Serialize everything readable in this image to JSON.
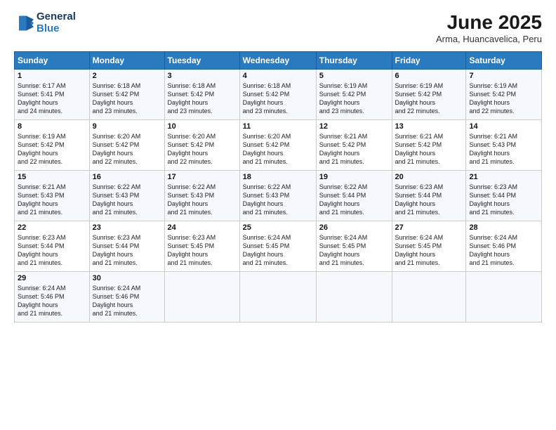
{
  "logo": {
    "general": "General",
    "blue": "Blue"
  },
  "header": {
    "month": "June 2025",
    "location": "Arma, Huancavelica, Peru"
  },
  "weekdays": [
    "Sunday",
    "Monday",
    "Tuesday",
    "Wednesday",
    "Thursday",
    "Friday",
    "Saturday"
  ],
  "weeks": [
    [
      {
        "day": "1",
        "sunrise": "6:17 AM",
        "sunset": "5:41 PM",
        "daylight": "11 hours and 24 minutes."
      },
      {
        "day": "2",
        "sunrise": "6:18 AM",
        "sunset": "5:42 PM",
        "daylight": "11 hours and 23 minutes."
      },
      {
        "day": "3",
        "sunrise": "6:18 AM",
        "sunset": "5:42 PM",
        "daylight": "11 hours and 23 minutes."
      },
      {
        "day": "4",
        "sunrise": "6:18 AM",
        "sunset": "5:42 PM",
        "daylight": "11 hours and 23 minutes."
      },
      {
        "day": "5",
        "sunrise": "6:19 AM",
        "sunset": "5:42 PM",
        "daylight": "11 hours and 23 minutes."
      },
      {
        "day": "6",
        "sunrise": "6:19 AM",
        "sunset": "5:42 PM",
        "daylight": "11 hours and 22 minutes."
      },
      {
        "day": "7",
        "sunrise": "6:19 AM",
        "sunset": "5:42 PM",
        "daylight": "11 hours and 22 minutes."
      }
    ],
    [
      {
        "day": "8",
        "sunrise": "6:19 AM",
        "sunset": "5:42 PM",
        "daylight": "11 hours and 22 minutes."
      },
      {
        "day": "9",
        "sunrise": "6:20 AM",
        "sunset": "5:42 PM",
        "daylight": "11 hours and 22 minutes."
      },
      {
        "day": "10",
        "sunrise": "6:20 AM",
        "sunset": "5:42 PM",
        "daylight": "11 hours and 22 minutes."
      },
      {
        "day": "11",
        "sunrise": "6:20 AM",
        "sunset": "5:42 PM",
        "daylight": "11 hours and 21 minutes."
      },
      {
        "day": "12",
        "sunrise": "6:21 AM",
        "sunset": "5:42 PM",
        "daylight": "11 hours and 21 minutes."
      },
      {
        "day": "13",
        "sunrise": "6:21 AM",
        "sunset": "5:42 PM",
        "daylight": "11 hours and 21 minutes."
      },
      {
        "day": "14",
        "sunrise": "6:21 AM",
        "sunset": "5:43 PM",
        "daylight": "11 hours and 21 minutes."
      }
    ],
    [
      {
        "day": "15",
        "sunrise": "6:21 AM",
        "sunset": "5:43 PM",
        "daylight": "11 hours and 21 minutes."
      },
      {
        "day": "16",
        "sunrise": "6:22 AM",
        "sunset": "5:43 PM",
        "daylight": "11 hours and 21 minutes."
      },
      {
        "day": "17",
        "sunrise": "6:22 AM",
        "sunset": "5:43 PM",
        "daylight": "11 hours and 21 minutes."
      },
      {
        "day": "18",
        "sunrise": "6:22 AM",
        "sunset": "5:43 PM",
        "daylight": "11 hours and 21 minutes."
      },
      {
        "day": "19",
        "sunrise": "6:22 AM",
        "sunset": "5:44 PM",
        "daylight": "11 hours and 21 minutes."
      },
      {
        "day": "20",
        "sunrise": "6:23 AM",
        "sunset": "5:44 PM",
        "daylight": "11 hours and 21 minutes."
      },
      {
        "day": "21",
        "sunrise": "6:23 AM",
        "sunset": "5:44 PM",
        "daylight": "11 hours and 21 minutes."
      }
    ],
    [
      {
        "day": "22",
        "sunrise": "6:23 AM",
        "sunset": "5:44 PM",
        "daylight": "11 hours and 21 minutes."
      },
      {
        "day": "23",
        "sunrise": "6:23 AM",
        "sunset": "5:44 PM",
        "daylight": "11 hours and 21 minutes."
      },
      {
        "day": "24",
        "sunrise": "6:23 AM",
        "sunset": "5:45 PM",
        "daylight": "11 hours and 21 minutes."
      },
      {
        "day": "25",
        "sunrise": "6:24 AM",
        "sunset": "5:45 PM",
        "daylight": "11 hours and 21 minutes."
      },
      {
        "day": "26",
        "sunrise": "6:24 AM",
        "sunset": "5:45 PM",
        "daylight": "11 hours and 21 minutes."
      },
      {
        "day": "27",
        "sunrise": "6:24 AM",
        "sunset": "5:45 PM",
        "daylight": "11 hours and 21 minutes."
      },
      {
        "day": "28",
        "sunrise": "6:24 AM",
        "sunset": "5:46 PM",
        "daylight": "11 hours and 21 minutes."
      }
    ],
    [
      {
        "day": "29",
        "sunrise": "6:24 AM",
        "sunset": "5:46 PM",
        "daylight": "11 hours and 21 minutes."
      },
      {
        "day": "30",
        "sunrise": "6:24 AM",
        "sunset": "5:46 PM",
        "daylight": "11 hours and 21 minutes."
      },
      null,
      null,
      null,
      null,
      null
    ]
  ]
}
